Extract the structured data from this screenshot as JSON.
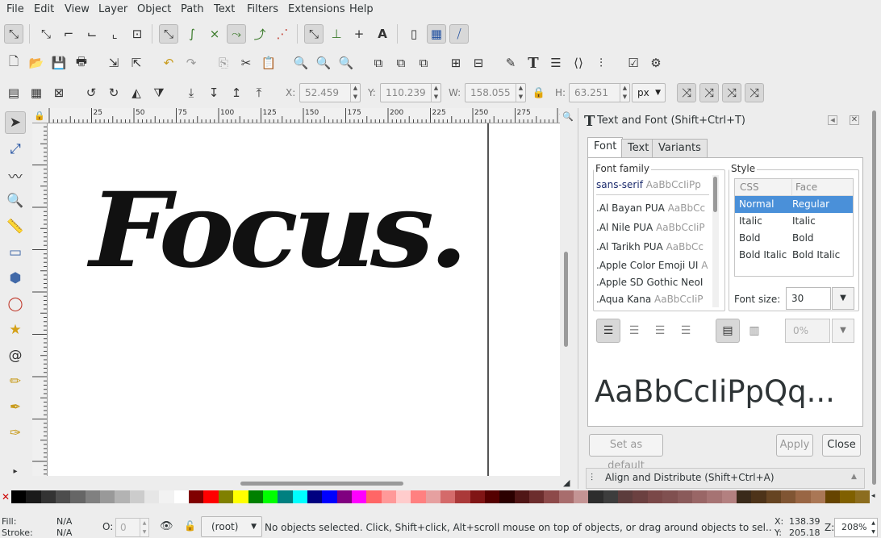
{
  "menu": [
    "File",
    "Edit",
    "View",
    "Layer",
    "Object",
    "Path",
    "Text",
    "Filters",
    "Extensions",
    "Help"
  ],
  "icons": {
    "snap": "snap-icon",
    "select": "selector-arrow-icon",
    "text_tool": "text-icon"
  },
  "transform": {
    "x_label": "X:",
    "x_value": "52.459",
    "y_label": "Y:",
    "y_value": "110.239",
    "w_label": "W:",
    "w_value": "158.055",
    "h_label": "H:",
    "h_value": "63.251",
    "unit": "px"
  },
  "ruler": {
    "ticks": [
      "25",
      "50",
      "75",
      "100",
      "125",
      "150",
      "175",
      "200",
      "225",
      "250",
      "275",
      "300"
    ]
  },
  "canvas": {
    "text": "Focus."
  },
  "dialog": {
    "title": "Text and Font (Shift+Ctrl+T)",
    "tabs": [
      "Font",
      "Text",
      "Variants"
    ],
    "font_family_label": "Font family",
    "fonts": [
      {
        "name": "sans-serif",
        "sample": "AaBbCcIiPp"
      },
      {
        "name": ".Al Bayan PUA",
        "sample": "AaBbCc"
      },
      {
        "name": ".Al Nile PUA",
        "sample": "AaBbCcIiP"
      },
      {
        "name": ".Al Tarikh PUA",
        "sample": "AaBbCc"
      },
      {
        "name": ".Apple Color Emoji UI",
        "sample": "A"
      },
      {
        "name": ".Apple SD Gothic NeoI",
        "sample": ""
      },
      {
        "name": ".Aqua Kana",
        "sample": "AaBbCcIiP"
      }
    ],
    "style_label": "Style",
    "style_headers": {
      "css": "CSS",
      "face": "Face"
    },
    "styles": [
      {
        "css": "Normal",
        "face": "Regular"
      },
      {
        "css": "Italic",
        "face": "Italic"
      },
      {
        "css": "Bold",
        "face": "Bold"
      },
      {
        "css": "Bold Italic",
        "face": "Bold Italic"
      }
    ],
    "font_size_label": "Font size:",
    "font_size_value": "30",
    "spacing_value": "0%",
    "preview": "AaBbCcIiPpQq...",
    "set_default": "Set as default",
    "apply": "Apply",
    "close": "Close",
    "align_panel": "Align and Distribute (Shift+Ctrl+A)"
  },
  "palette_colors": [
    "#000000",
    "#1a1a1a",
    "#333333",
    "#4d4d4d",
    "#666666",
    "#808080",
    "#999999",
    "#b3b3b3",
    "#cccccc",
    "#e6e6e6",
    "#f2f2f2",
    "#ffffff",
    "#800000",
    "#ff0000",
    "#808000",
    "#ffff00",
    "#008000",
    "#00ff00",
    "#008080",
    "#00ffff",
    "#000080",
    "#0000ff",
    "#800080",
    "#ff00ff",
    "#ff6666",
    "#ff9999",
    "#ffcccc",
    "#ff8080",
    "#e6a0a0",
    "#d46a6a",
    "#aa3939",
    "#801515",
    "#550000",
    "#2b0000",
    "#501616",
    "#6c2d2d",
    "#8d4a4a",
    "#a86d6d",
    "#c49494",
    "#2d2d2d",
    "#3d3d3d",
    "#5c3c3c",
    "#6b4040",
    "#7a4848",
    "#805050",
    "#8a5a5a",
    "#996666",
    "#a67373",
    "#b38080",
    "#3a2a1a",
    "#4d3319",
    "#664422",
    "#805533",
    "#996644",
    "#aa7755",
    "#664400",
    "#806000",
    "#8c6d1f"
  ],
  "status": {
    "fill_label": "Fill:",
    "fill_value": "N/A",
    "stroke_label": "Stroke:",
    "stroke_value": "N/A",
    "opacity_label": "O:",
    "opacity_value": "0",
    "layer": "(root)",
    "message": "No objects selected. Click, Shift+click, Alt+scroll mouse on top of objects, or drag around objects to sel...",
    "x_label": "X:",
    "x_value": "138.39",
    "y_label": "Y:",
    "y_value": "205.18",
    "z_label": "Z:",
    "zoom": "208%"
  }
}
